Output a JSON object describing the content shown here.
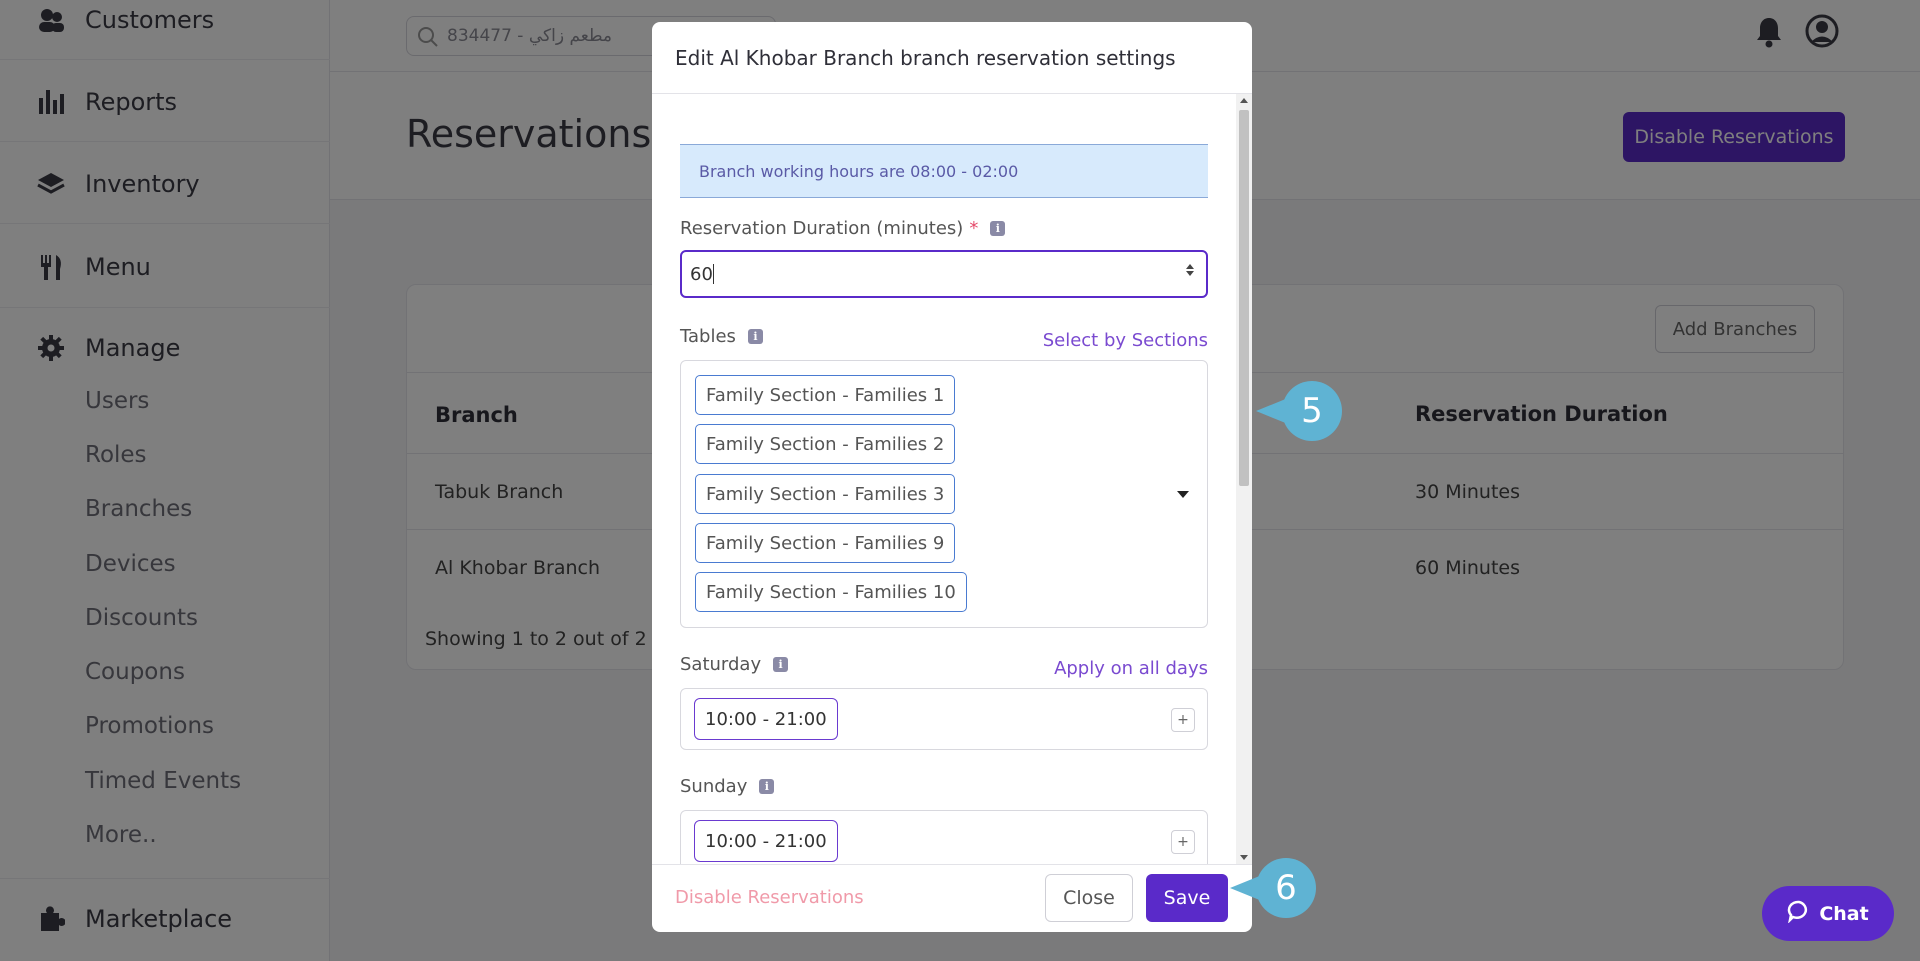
{
  "sidebar": {
    "items": [
      {
        "label": "Customers",
        "icon": "customers-icon"
      },
      {
        "label": "Reports",
        "icon": "reports-icon"
      },
      {
        "label": "Inventory",
        "icon": "inventory-icon"
      },
      {
        "label": "Menu",
        "icon": "menu-icon"
      },
      {
        "label": "Manage",
        "icon": "gear-icon"
      },
      {
        "label": "Marketplace",
        "icon": "puzzle-icon"
      }
    ],
    "manage_sub": [
      "Users",
      "Roles",
      "Branches",
      "Devices",
      "Discounts",
      "Coupons",
      "Promotions",
      "Timed Events",
      "More.."
    ]
  },
  "topbar": {
    "search_value": "مطعم زاكي - 834477"
  },
  "page": {
    "title": "Reservations",
    "disable_button": "Disable Reservations",
    "add_branches_button": "Add Branches",
    "table": {
      "headers": {
        "branch": "Branch",
        "duration": "Reservation Duration"
      },
      "rows": [
        {
          "branch": "Tabuk Branch",
          "duration": "30 Minutes"
        },
        {
          "branch": "Al Khobar Branch",
          "duration": "60 Minutes"
        }
      ]
    },
    "showing": "Showing 1 to 2 out of 2"
  },
  "modal": {
    "title": "Edit Al Khobar Branch branch reservation settings",
    "info_alert": "Branch working hours are 08:00 - 02:00",
    "duration_label": "Reservation Duration (minutes)",
    "duration_required": "*",
    "duration_value": "60",
    "tables_label": "Tables",
    "select_by_sections": "Select by Sections",
    "tables": [
      "Family Section - Families 1",
      "Family Section - Families 2",
      "Family Section - Families 3",
      "Family Section - Families 9",
      "Family Section - Families 10"
    ],
    "days": [
      {
        "label": "Saturday",
        "time": "10:00 - 21:00"
      },
      {
        "label": "Sunday",
        "time": "10:00 - 21:00"
      }
    ],
    "apply_all_days": "Apply on all days",
    "plus": "+",
    "footer": {
      "disable": "Disable Reservations",
      "close": "Close",
      "save": "Save"
    }
  },
  "callouts": [
    "5",
    "6"
  ],
  "chat": "Chat",
  "colors": {
    "primary": "#5a2ac9",
    "callout": "#5fb3d3",
    "link": "#7a4ad0"
  }
}
